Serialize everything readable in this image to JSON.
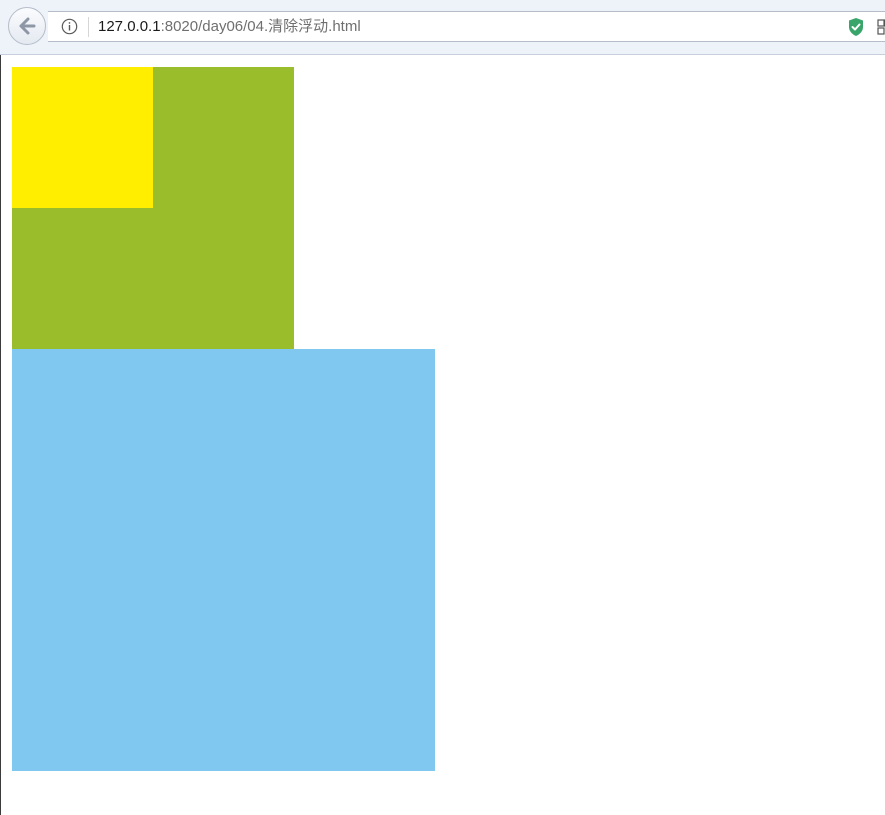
{
  "browser": {
    "url_host": "127.0.0.1",
    "url_path": ":8020/day06/04.清除浮动.html",
    "icons": {
      "back": "back-arrow-icon",
      "info": "info-icon",
      "shield": "shield-check-icon",
      "extension": "extension-icon"
    }
  },
  "page": {
    "boxes": [
      {
        "name": "yellow-box",
        "color": "#ffee00"
      },
      {
        "name": "green-box",
        "color": "#9abd2c"
      },
      {
        "name": "blue-box",
        "color": "#80c8ef"
      }
    ]
  }
}
